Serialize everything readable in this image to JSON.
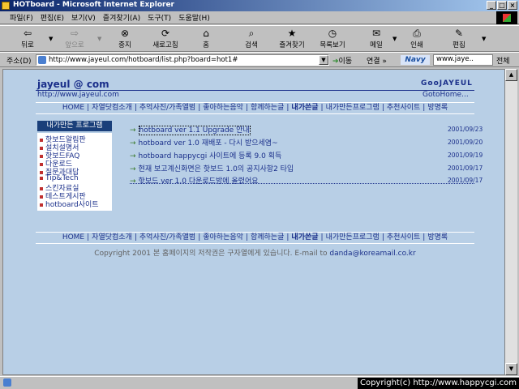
{
  "window": {
    "title": "HOTboard - Microsoft Internet Explorer",
    "minimize": "_",
    "maximize": "□",
    "close": "×"
  },
  "menu": [
    "파일(F)",
    "편집(E)",
    "보기(V)",
    "즐겨찾기(A)",
    "도구(T)",
    "도움말(H)"
  ],
  "toolbar": {
    "back": "뒤로",
    "forward": "앞으로",
    "stop": "중지",
    "refresh": "새로고침",
    "home": "홈",
    "search": "검색",
    "favorites": "즐겨찾기",
    "history": "목록보기",
    "mail": "메일",
    "print": "인쇄",
    "edit": "편집"
  },
  "address": {
    "label": "주소(D)",
    "url": "http://www.jayeul.com/hotboard/list.php?board=hot1#",
    "go": "이동",
    "links": "연결 »",
    "navy": "Navy",
    "search_value": "www.jaye..",
    "search_label": "전체"
  },
  "page": {
    "site_title": "jayeul @ com",
    "brand": "GooJAYEUL",
    "site_url": "http://www.jayeul.com",
    "gohome": "GotoHome...",
    "nav": [
      "HOME",
      "자열닷컴소개",
      "추억사진/가족앨범",
      "좋아하는음악",
      "함께하는글",
      "내가쓴글",
      "내가만든프로그램",
      "추천사이트",
      "방명록"
    ],
    "side_header": "내가만든 프로그램",
    "side_items": [
      "핫보드알림판",
      "설치설명서",
      "핫보드FAQ",
      "다운로드",
      "질문과대답",
      "Tip&Tech",
      "스킨자료실",
      "테스트게시판",
      "hotboard사이트"
    ],
    "posts": [
      {
        "title": "hotboard ver 1.1 Upgrade 안내",
        "date": "2001/09/23"
      },
      {
        "title": "hotboard ver 1.0 재배포 - 다시 받으세염~",
        "date": "2001/09/20"
      },
      {
        "title": "hotboard happycgi 사이트에 등록 9.0 획득",
        "date": "2001/09/19"
      },
      {
        "title": "현재 보고계신화면은 핫보드 1.0의 공지사항2 타입",
        "date": "2001/09/17"
      },
      {
        "title": "핫보드 ver 1.0 다운로드방에 올렸어요",
        "date": "2001/09/17"
      }
    ],
    "copyright": "Copyright 2001 본 홈페이지의 저작권은 구자열에게 있습니다. E-mail to",
    "email": "danda@koreamail.co.kr"
  },
  "stamp": "Copyright(c) http://www.happycgi.com"
}
